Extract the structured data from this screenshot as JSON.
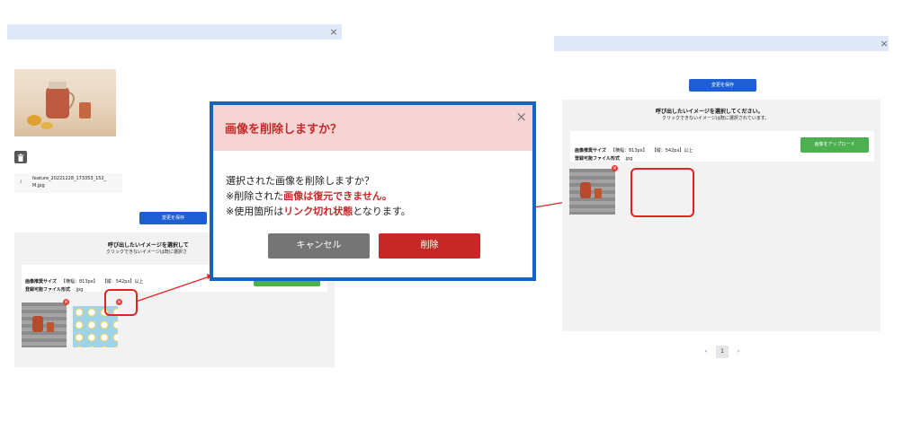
{
  "left": {
    "close_glyph": "×",
    "file_name_line1": "feature_20221228_173353_152_",
    "file_name_line2": "M.jpg",
    "file_icon": "↕",
    "trash_icon": "trash-icon",
    "save_button": "変更を保存",
    "panel_heading": "呼び出したいイメージを選択して",
    "panel_sub": "クリックできないイメージは既に選択さ",
    "size_label": "画像推奨サイズ",
    "size_width": "【横幅：813px】",
    "size_height": "【縦：542px】以上",
    "format_label": "登録可能ファイル形式",
    "format_value": ".jpg"
  },
  "modal": {
    "title": "画像を削除しますか？",
    "close_glyph": "×",
    "line1": "選択された画像を削除しますか？",
    "line2_prefix": "※削除された",
    "line2_red": "画像は復元できません。",
    "line3_prefix": "※使用箇所は",
    "line3_red": "リンク切れ状態",
    "line3_suffix": "となります。",
    "cancel_button": "キャンセル",
    "delete_button": "削除"
  },
  "right": {
    "close_glyph": "×",
    "save_button": "変更を保存",
    "panel_heading": "呼び出したいイメージを選択してください。",
    "panel_sub": "クリックできないイメージは既に選択されています。",
    "size_label": "画像推奨サイズ",
    "size_width": "【横幅：813px】",
    "size_height": "【縦：542px】以上",
    "format_label": "登録可能ファイル形式",
    "format_value": ".jpg",
    "upload_button": "画像をアップロード",
    "pagination": {
      "prev": "‹",
      "current": "1",
      "next": "›"
    }
  },
  "colors": {
    "titlebar": "#dfe8f6",
    "accent_blue": "#1e5fd3",
    "upload_green": "#4caf50",
    "modal_border": "#1565c0",
    "delete_red": "#c62828",
    "cancel_gray": "#757575",
    "highlight_red": "#e02424"
  }
}
